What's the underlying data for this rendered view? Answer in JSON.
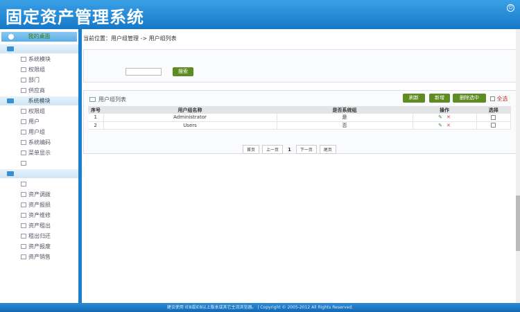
{
  "header": {
    "title": "固定资产管理系统",
    "power_icon": "power-icon"
  },
  "sidebar": {
    "desktop": "我的桌面",
    "groups": [
      {
        "label": "",
        "items": [
          "系统模块",
          "权限组",
          "部门",
          "供应商"
        ]
      },
      {
        "label": "系统模块",
        "items": [
          "权限组",
          "用户",
          "用户组",
          "系统编码",
          "菜单显示",
          ""
        ]
      },
      {
        "label": "",
        "items": [
          "",
          "资产调拨",
          "资产报损",
          "资产维修",
          "资产租出",
          "租出归还",
          "资产报废",
          "资产销售"
        ]
      }
    ]
  },
  "breadcrumb": "当前位置：用户组管理 -> 用户组列表",
  "search": {
    "button": "搜索",
    "value": ""
  },
  "list": {
    "title": "用户组列表",
    "buttons": {
      "refresh": "刷新",
      "add": "新增",
      "delete_selected": "删除选中"
    },
    "select_all": "全选",
    "columns": [
      "序号",
      "用户组名称",
      "是否系统组",
      "操作",
      "选择"
    ],
    "rows": [
      {
        "no": "1",
        "name": "Administrator",
        "system": "是"
      },
      {
        "no": "2",
        "name": "Users",
        "system": "否"
      }
    ]
  },
  "pager": {
    "first": "首页",
    "prev": "上一页",
    "current": "1",
    "next": "下一页",
    "last": "尾页"
  },
  "footer": "建议使用 IE8或IE8以上版本或其它主流浏览器。 | Copyright © 2005-2012 All Rights Reserved."
}
